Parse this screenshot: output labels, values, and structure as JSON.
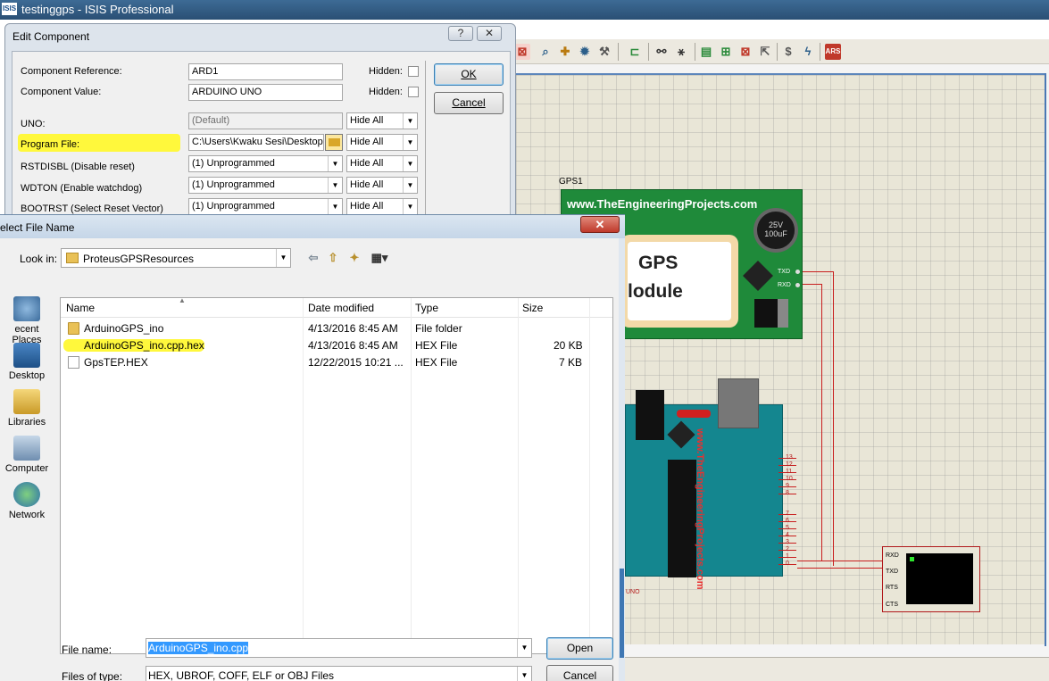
{
  "app": {
    "title": "testinggps - ISIS Professional",
    "logo_text": "ISIS"
  },
  "schematic": {
    "gps_ref": "GPS1",
    "gps_url": "www.TheEngineeringProjects.com",
    "gps_word1": "GPS",
    "gps_word2": "lodule",
    "gps_cap": "25V 100uF",
    "gps_txd": "TXD",
    "gps_rxd": "RXD",
    "arduino_url": "www.TheEngineeringProjects.com",
    "arduino_caption": "UNO",
    "arduino_pins": [
      "13",
      "12",
      "11",
      "10",
      "9",
      "8",
      "7",
      "6",
      "5",
      "4",
      "3",
      "2",
      "1",
      "0"
    ],
    "terminal_labels": [
      "RXD",
      "TXD",
      "RTS",
      "CTS"
    ]
  },
  "edit_dialog": {
    "title": "Edit Component",
    "help": "?",
    "close": "✕",
    "ref_label": "Component Reference:",
    "ref_value": "ARD1",
    "val_label": "Component Value:",
    "val_value": "ARDUINO UNO",
    "hidden_label": "Hidden:",
    "ok": "OK",
    "cancel": "Cancel",
    "rows": [
      {
        "label": "UNO:",
        "value": "(Default)",
        "vis": "Hide All"
      },
      {
        "label": "Program File:",
        "value": "C:\\Users\\Kwaku Sesi\\Desktop",
        "vis": "Hide All"
      },
      {
        "label": "RSTDISBL (Disable reset)",
        "value": "(1) Unprogrammed",
        "vis": "Hide All"
      },
      {
        "label": "WDTON (Enable watchdog)",
        "value": "(1) Unprogrammed",
        "vis": "Hide All"
      },
      {
        "label": "BOOTRST (Select Reset Vector)",
        "value": "(1) Unprogrammed",
        "vis": "Hide All"
      }
    ]
  },
  "file_dialog": {
    "title": "elect File Name",
    "close": "✕",
    "look_in_label": "Look in:",
    "look_in_value": "ProteusGPSResources",
    "places": [
      "ecent Places",
      "Desktop",
      "Libraries",
      "Computer",
      "Network"
    ],
    "columns": [
      "Name",
      "Date modified",
      "Type",
      "Size"
    ],
    "files": [
      {
        "name": "ArduinoGPS_ino",
        "date": "4/13/2016 8:45 AM",
        "type": "File folder",
        "size": "",
        "kind": "folder"
      },
      {
        "name": "ArduinoGPS_ino.cpp.hex",
        "date": "4/13/2016 8:45 AM",
        "type": "HEX File",
        "size": "20 KB",
        "kind": "file"
      },
      {
        "name": "GpsTEP.HEX",
        "date": "12/22/2015 10:21 ...",
        "type": "HEX File",
        "size": "7 KB",
        "kind": "file"
      }
    ],
    "filename_label": "File name:",
    "filename_value": "ArduinoGPS_ino.cpp",
    "filetype_label": "Files of type:",
    "filetype_value": "HEX, UBROF, COFF, ELF or OBJ Files",
    "open": "Open",
    "cancel": "Cancel"
  }
}
